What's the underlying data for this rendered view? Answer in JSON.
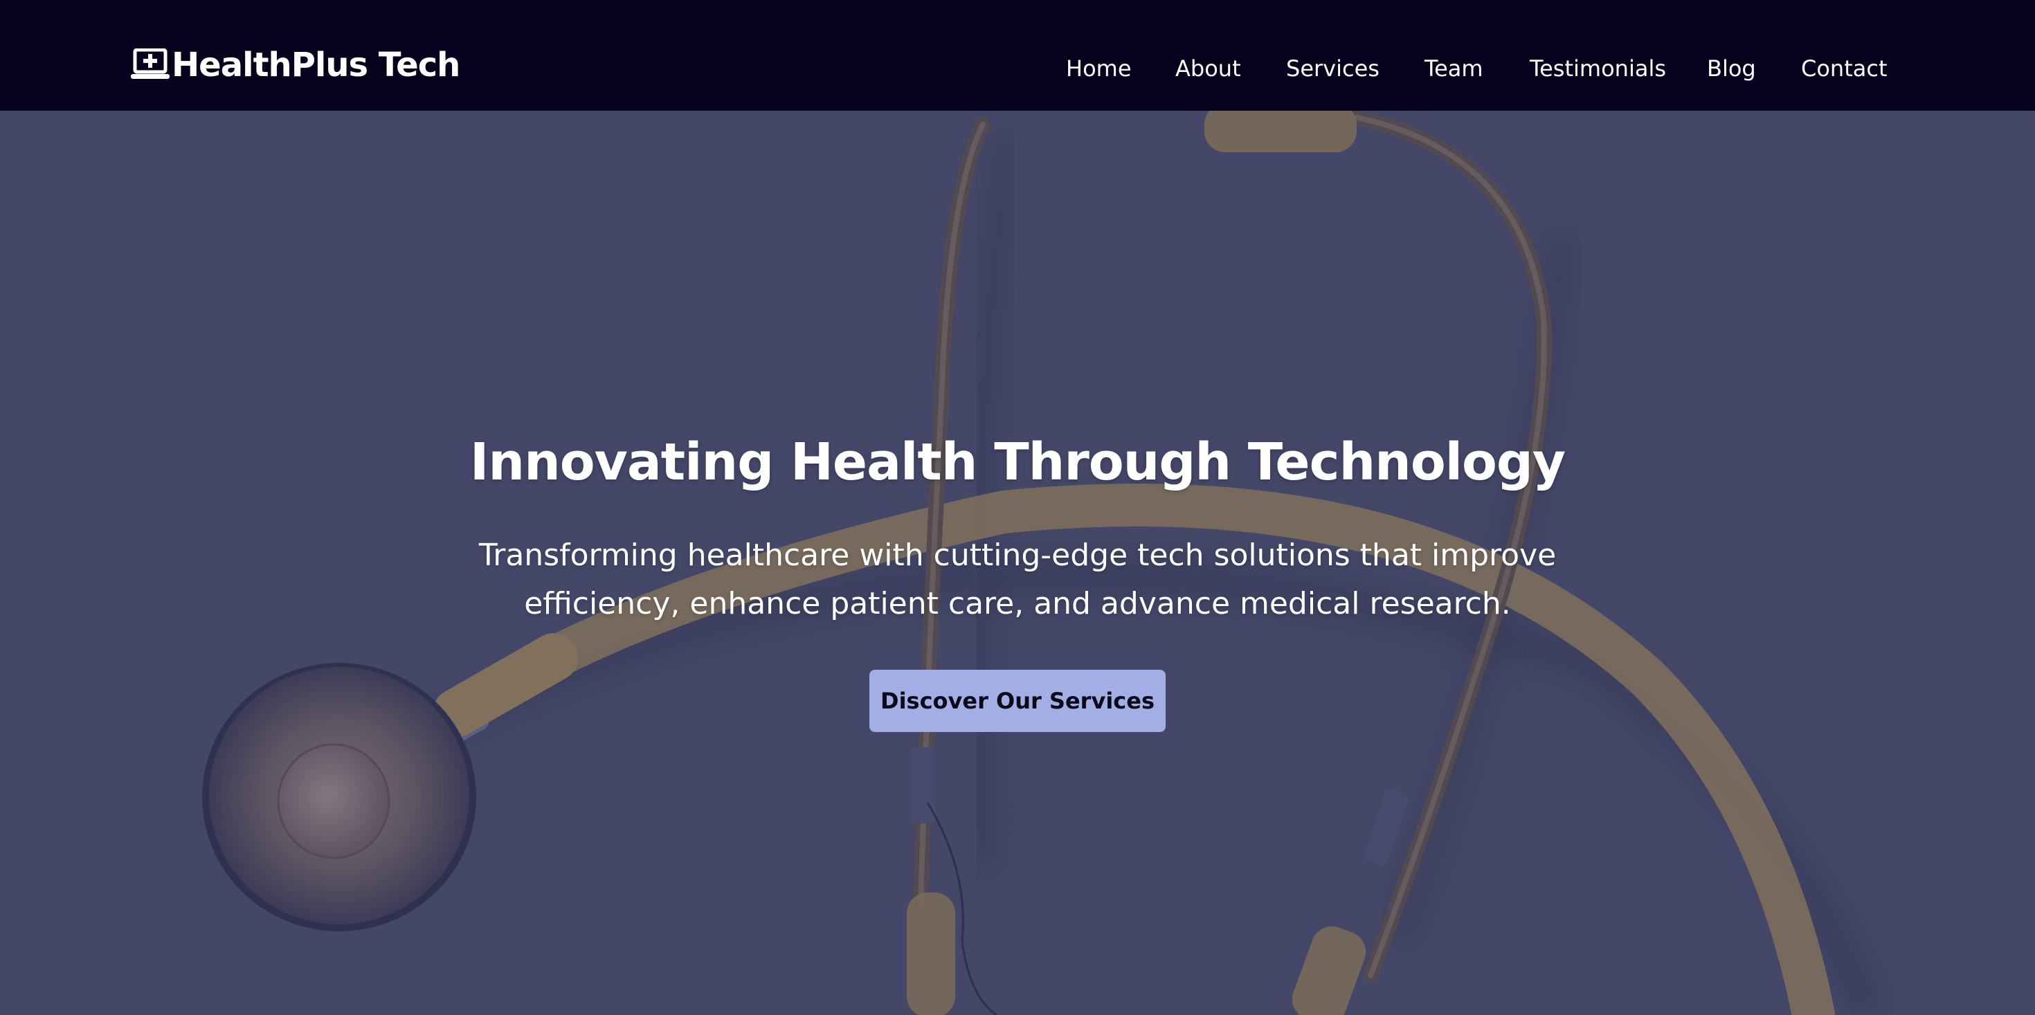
{
  "header": {
    "brand": {
      "name": "HealthPlus Tech",
      "icon": "laptop-medical-icon"
    },
    "nav": [
      {
        "label": "Home"
      },
      {
        "label": "About"
      },
      {
        "label": "Services"
      },
      {
        "label": "Team"
      },
      {
        "label": "Testimonials"
      },
      {
        "label": "Blog"
      },
      {
        "label": "Contact"
      }
    ]
  },
  "hero": {
    "title": "Innovating Health Through Technology",
    "subtitle": "Transforming healthcare with cutting-edge tech solutions that improve efficiency, enhance patient care, and advance medical research.",
    "cta_label": "Discover Our Services",
    "background_image": "stethoscope-photo"
  },
  "colors": {
    "header_bg": "#04021d",
    "hero_bg": "#474a66",
    "cta_bg": "#a3aee4",
    "text": "#ffffff",
    "stethoscope_tube": "#b69a4e"
  }
}
